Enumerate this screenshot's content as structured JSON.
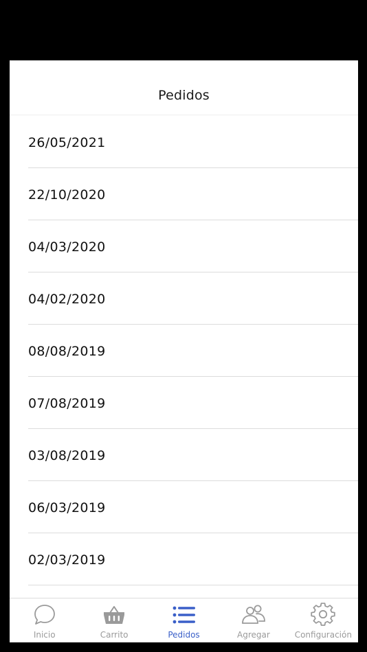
{
  "header": {
    "title": "Pedidos"
  },
  "orders": [
    {
      "date": "26/05/2021"
    },
    {
      "date": "22/10/2020"
    },
    {
      "date": "04/03/2020"
    },
    {
      "date": "04/02/2020"
    },
    {
      "date": "08/08/2019"
    },
    {
      "date": "07/08/2019"
    },
    {
      "date": "03/08/2019"
    },
    {
      "date": "06/03/2019"
    },
    {
      "date": "02/03/2019"
    }
  ],
  "tabs": [
    {
      "label": "Inicio",
      "icon": "chat-bubble-icon",
      "active": false
    },
    {
      "label": "Carrito",
      "icon": "basket-icon",
      "active": false
    },
    {
      "label": "Pedidos",
      "icon": "list-icon",
      "active": true
    },
    {
      "label": "Agregar",
      "icon": "people-icon",
      "active": false
    },
    {
      "label": "Configuración",
      "icon": "gear-icon",
      "active": false
    }
  ],
  "colors": {
    "active_tab": "#3a5fc8",
    "inactive_tab": "#9a9a9a",
    "background": "#ffffff",
    "frame": "#000000"
  }
}
